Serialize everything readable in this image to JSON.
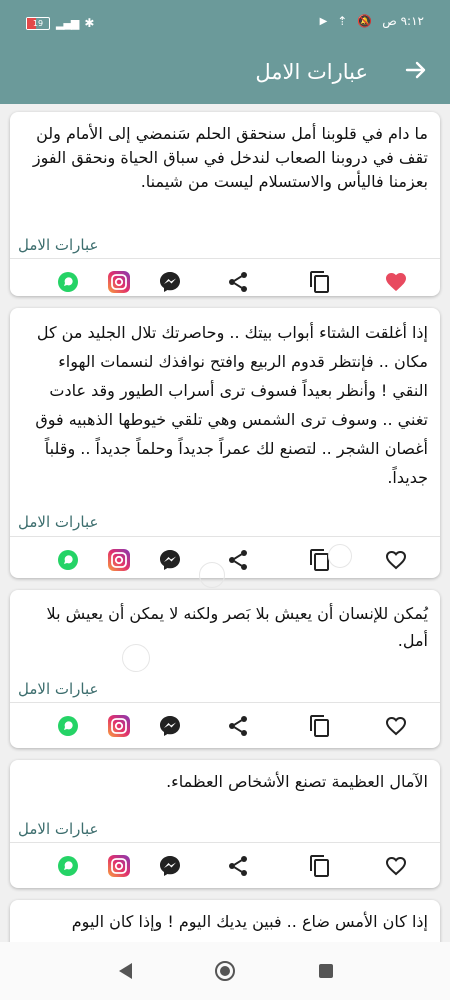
{
  "status_bar": {
    "battery": "19",
    "time": "٩:١٢ ص"
  },
  "app_bar": {
    "title": "عبارات الامل",
    "back_icon": "arrow-right-icon"
  },
  "cards": [
    {
      "text": "ما دام في قلوبنا أمل سنحقق الحلم سَنمضي إلى الأمام ولن تقف في دروبنا الصعاب لندخل في سباق الحياة ونحقق الفوز بعزمنا فاليأس والاستسلام ليست من شيمنا.",
      "category": "عبارات الامل",
      "favorite": true
    },
    {
      "text": "إذا أغلقت الشتاء أبواب بيتك .. وحاصرتك تلال الجليد من كل مكان .. فإنتظر قدوم الربيع وافتح نوافذك لنسمات الهواء النقي ! وأنظر بعيداً فسوف ترى أسراب الطيور وقد عادت تغني .. وسوف ترى الشمس وهي تلقي خيوطها الذهبيه فوق أغصان الشجر .. لتصنع لك عمراً جديداً وحلماً جديداً .. وقلباً جديداً.",
      "category": "عبارات الامل",
      "favorite": false
    },
    {
      "text": "يُمكن للإنسان أن يعيش بلا بَصر ولكنه لا يمكن أن يعيش بلا أمل.",
      "category": "عبارات الامل",
      "favorite": false
    },
    {
      "text": "الآمال العظيمة تصنع الأشخاص العظماء.",
      "category": "عبارات الامل",
      "favorite": false
    },
    {
      "text": "إذا كان الأمس ضاع .. فبين يديك اليوم ! وإذا كان اليوم",
      "category": "",
      "favorite": false
    }
  ],
  "colors": {
    "primary": "#6b9a9a",
    "category_text": "#3d6e6e",
    "favorite_active": "#e84a5f",
    "whatsapp": "#25d366"
  },
  "icons": [
    "heart-icon",
    "copy-icon",
    "share-icon",
    "messenger-icon",
    "instagram-icon",
    "whatsapp-icon"
  ]
}
